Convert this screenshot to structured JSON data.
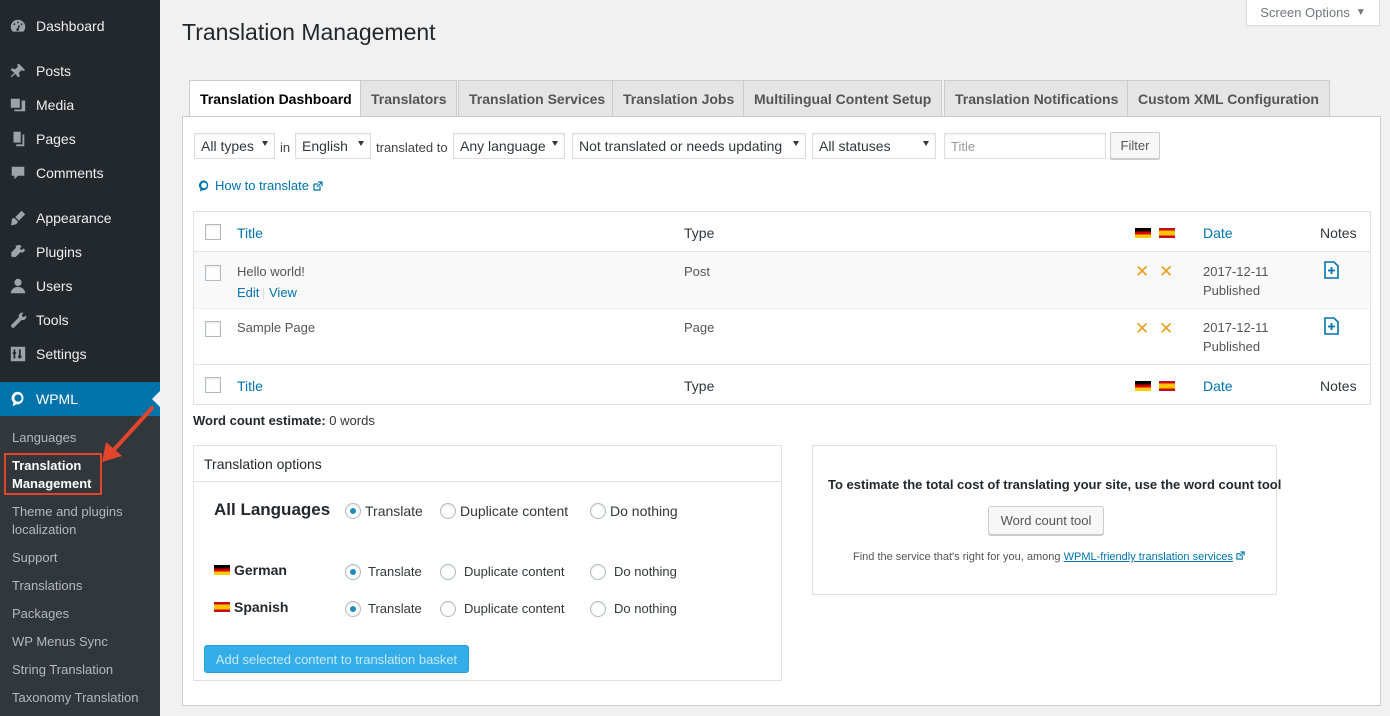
{
  "sidebar": {
    "menu": [
      {
        "label": "Dashboard",
        "icon": "dashboard-icon"
      },
      {
        "label": "Posts",
        "icon": "pin-icon"
      },
      {
        "label": "Media",
        "icon": "media-icon"
      },
      {
        "label": "Pages",
        "icon": "pages-icon"
      },
      {
        "label": "Comments",
        "icon": "comment-icon"
      },
      {
        "label": "Appearance",
        "icon": "brush-icon"
      },
      {
        "label": "Plugins",
        "icon": "plug-icon"
      },
      {
        "label": "Users",
        "icon": "user-icon"
      },
      {
        "label": "Tools",
        "icon": "wrench-icon"
      },
      {
        "label": "Settings",
        "icon": "settings-icon"
      },
      {
        "label": "WPML",
        "icon": "wpml-icon"
      }
    ],
    "submenu": [
      {
        "label": "Languages"
      },
      {
        "label": "Translation Management"
      },
      {
        "label": "Theme and plugins localization"
      },
      {
        "label": "Support"
      },
      {
        "label": "Translations"
      },
      {
        "label": "Packages"
      },
      {
        "label": "WP Menus Sync"
      },
      {
        "label": "String Translation"
      },
      {
        "label": "Taxonomy Translation"
      }
    ]
  },
  "header": {
    "screen_options": "Screen Options",
    "title": "Translation Management"
  },
  "tabs": [
    {
      "label": "Translation Dashboard",
      "active": true
    },
    {
      "label": "Translators"
    },
    {
      "label": "Translation Services"
    },
    {
      "label": "Translation Jobs"
    },
    {
      "label": "Multilingual Content Setup"
    },
    {
      "label": "Translation Notifications"
    },
    {
      "label": "Custom XML Configuration"
    }
  ],
  "filters": {
    "type": "All types",
    "in_label": "in",
    "source_language": "English",
    "translated_to_label": "translated to",
    "target_language": "Any language",
    "translation_status": "Not translated or needs updating",
    "status": "All statuses",
    "title_placeholder": "Title",
    "filter_button": "Filter"
  },
  "how_to_translate": "How to translate",
  "table": {
    "columns": {
      "title": "Title",
      "type": "Type",
      "date": "Date",
      "notes": "Notes"
    },
    "rows": [
      {
        "title": "Hello world!",
        "type": "Post",
        "date": "2017-12-11",
        "status": "Published",
        "actions": [
          "Edit",
          "View"
        ],
        "translations": [
          "not translated",
          "not translated"
        ]
      },
      {
        "title": "Sample Page",
        "type": "Page",
        "date": "2017-12-11",
        "status": "Published",
        "actions": [],
        "translations": [
          "not translated",
          "not translated"
        ]
      }
    ]
  },
  "word_count": {
    "label": "Word count estimate:",
    "value": "0 words"
  },
  "translation_options": {
    "heading": "Translation options",
    "all_languages": "All Languages",
    "options": [
      "Translate",
      "Duplicate content",
      "Do nothing"
    ],
    "languages": [
      {
        "name": "German",
        "selected": "Translate"
      },
      {
        "name": "Spanish",
        "selected": "Translate"
      }
    ],
    "basket_button": "Add selected content to translation basket"
  },
  "word_count_tool": {
    "title": "To estimate the total cost of translating your site, use the word count tool",
    "button": "Word count tool",
    "find_text": "Find the service that's right for you, among",
    "link_text": "WPML-friendly translation services"
  },
  "colors": {
    "sidebar_bg": "#23282d",
    "active_menu": "#0073aa",
    "link": "#0073aa",
    "highlight_border": "#e2452b",
    "not_translated": "#e6a01e",
    "primary_button": "#33aee8"
  }
}
